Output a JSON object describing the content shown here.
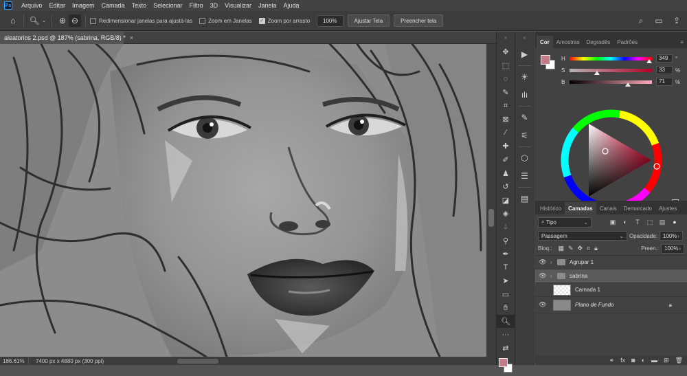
{
  "app": {
    "logo": "Ps"
  },
  "menu": [
    "Arquivo",
    "Editar",
    "Imagem",
    "Camada",
    "Texto",
    "Selecionar",
    "Filtro",
    "3D",
    "Visualizar",
    "Janela",
    "Ajuda"
  ],
  "options": {
    "resize_windows": "Redimensionar janelas para ajustá-las",
    "zoom_all": "Zoom em Janelas",
    "scrubby_zoom": "Zoom por arrasto",
    "zoom_value": "100%",
    "fit_screen": "Ajustar Tela",
    "fill_screen": "Preencher tela",
    "resize_windows_checked": false,
    "zoom_all_checked": false,
    "scrubby_zoom_checked": true
  },
  "document": {
    "tab_title": "aleatorios 2.psd @ 187% (sabrina, RGB/8) *",
    "close": "×"
  },
  "status": {
    "zoom": "186.61%",
    "dimensions": "7400 px x 4880 px (300 ppi)"
  },
  "color_panel": {
    "tabs": [
      "Cor",
      "Amostras",
      "Degradês",
      "Padrões"
    ],
    "h_label": "H",
    "s_label": "S",
    "b_label": "B",
    "h_value": "349",
    "s_value": "33",
    "b_value": "71",
    "h_unit": "°",
    "s_unit": "%",
    "b_unit": "%",
    "foreground": "#c27b87",
    "background": "#ffffff"
  },
  "layers_panel": {
    "tabs": [
      "Histórico",
      "Camadas",
      "Canais",
      "Demarcado",
      "Ajustes"
    ],
    "filter": "Tipo",
    "blend_mode": "Passagem",
    "opacity_label": "Opacidade:",
    "opacity": "100%",
    "lock_label": "Bloq.:",
    "fill_label": "Preen.:",
    "fill": "100%",
    "layers": [
      {
        "name": "Agrupar 1",
        "type": "group",
        "visible": true,
        "selected": false
      },
      {
        "name": "sabrina",
        "type": "group",
        "visible": true,
        "selected": true
      },
      {
        "name": "Camada 1",
        "type": "layer",
        "visible": false,
        "selected": false
      },
      {
        "name": "Plano de Fundo",
        "type": "background",
        "visible": true,
        "selected": false
      }
    ]
  }
}
